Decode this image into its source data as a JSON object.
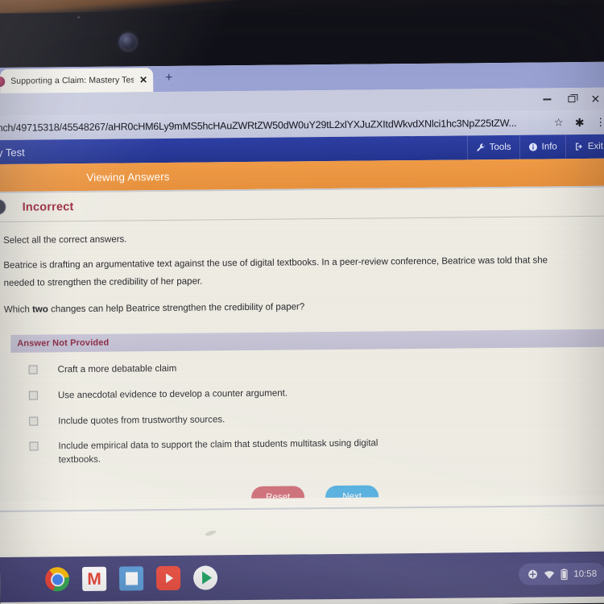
{
  "browser": {
    "tab": {
      "title": "Supporting a Claim: Mastery Tes",
      "close_label": "✕",
      "favicon_name": "site-favicon"
    },
    "new_tab_label": "+",
    "window_controls": {
      "minimize": "–",
      "restore": "⧉",
      "close": "✕"
    },
    "omnibox": {
      "url": "nch/49715318/45548267/aHR0cHM6Ly9mMS5hcHAuZWRtZW50dW0uY29tL2xlYXJuZXItdWkvdXNlci1hc3NpZ25tZW...",
      "bookmark_label": "☆",
      "extensions_label": "✱",
      "menu_label": "⋮"
    }
  },
  "appbar": {
    "title": "y Test",
    "tools_label": "Tools",
    "info_label": "Info",
    "exit_label": "Exit",
    "background_color": "#2a3a9b"
  },
  "orangebar": {
    "label": "Viewing Answers",
    "background_color": "#ee9543"
  },
  "question": {
    "status": "Incorrect",
    "status_color": "#9d2b41",
    "instruction": "Select all the correct answers.",
    "paragraph_1": "Beatrice is drafting an argumentative text against the use of digital textbooks. In a peer-review conference, Beatrice was told that she needed to strengthen the credibility of her paper.",
    "prompt_pre": "Which ",
    "prompt_bold": "two",
    "prompt_post": " changes can help Beatrice strengthen the credibility of paper?",
    "answer_banner": "Answer Not Provided",
    "options": [
      {
        "label": "Craft a more debatable claim",
        "checked": false
      },
      {
        "label": "Use anecdotal evidence to develop a counter argument.",
        "checked": false
      },
      {
        "label": "Include quotes from trustworthy sources.",
        "checked": false
      },
      {
        "label": "Include empirical data to support the claim that students multitask using digital textbooks.",
        "checked": false
      }
    ],
    "reset_label": "Reset",
    "next_label": "Next",
    "reset_color": "#cc6a74",
    "next_color": "#53aede"
  },
  "shelf": {
    "apps": [
      {
        "name": "chrome"
      },
      {
        "name": "gmail",
        "glyph": "M"
      },
      {
        "name": "docs"
      },
      {
        "name": "youtube"
      },
      {
        "name": "play-store"
      }
    ],
    "tray": {
      "time": "10:58"
    }
  }
}
